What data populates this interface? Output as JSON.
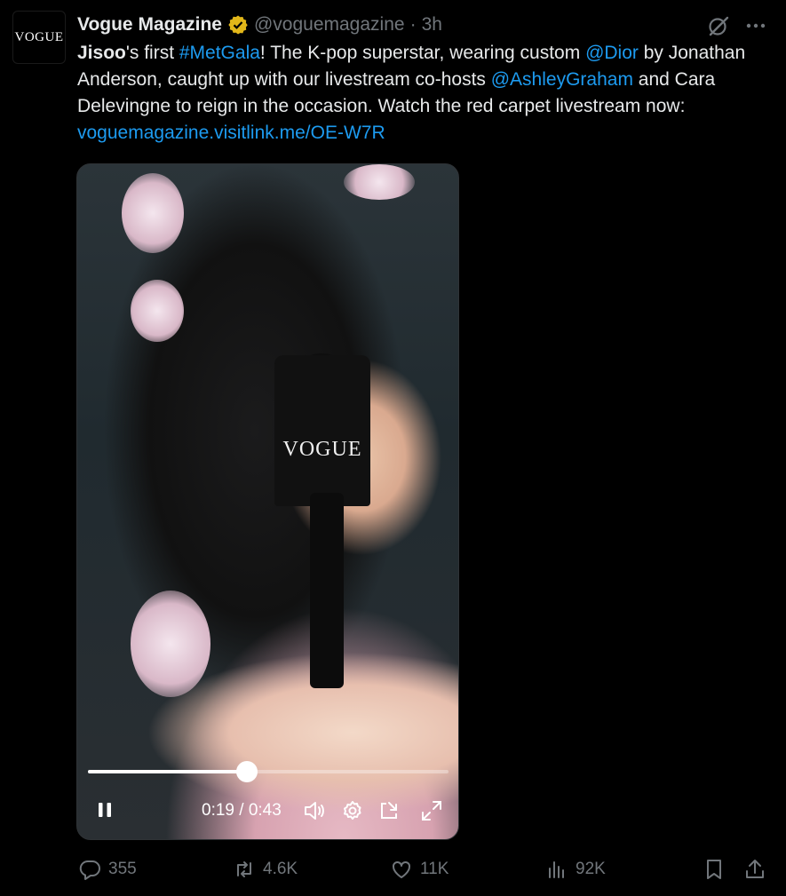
{
  "account": {
    "avatar_text": "VOGUE",
    "display_name": "Vogue Magazine",
    "handle": "@voguemagazine",
    "separator": "·",
    "time": "3h"
  },
  "tweet": {
    "segments": [
      {
        "text": "Jisoo",
        "style": "bold"
      },
      {
        "text": "'s first ",
        "style": "plain"
      },
      {
        "text": "#MetGala",
        "style": "link"
      },
      {
        "text": "! The K-pop superstar, wearing custom ",
        "style": "plain"
      },
      {
        "text": "@Dior",
        "style": "link"
      },
      {
        "text": " by Jonathan Anderson, caught up with our livestream co-hosts ",
        "style": "plain"
      },
      {
        "text": "@AshleyGraham",
        "style": "link"
      },
      {
        "text": " and Cara Delevingne to reign in the occasion. Watch the red carpet livestream now: ",
        "style": "plain"
      },
      {
        "text": "voguemagazine.visitlink.me/OE-W7R",
        "style": "link"
      }
    ]
  },
  "video": {
    "mic_brand": "VOGUE",
    "progress_fraction": 0.44,
    "time_label": "0:19 / 0:43",
    "controls": [
      "pause-icon",
      "volume-icon",
      "settings-icon",
      "pip-icon",
      "fullscreen-icon"
    ]
  },
  "actions": {
    "replies": "355",
    "reposts": "4.6K",
    "likes": "11K",
    "views": "92K"
  },
  "colors": {
    "background": "#000000",
    "text": "#e7e9ea",
    "secondary": "#71767b",
    "link": "#1d9bf0",
    "verified": "#e2b719"
  }
}
